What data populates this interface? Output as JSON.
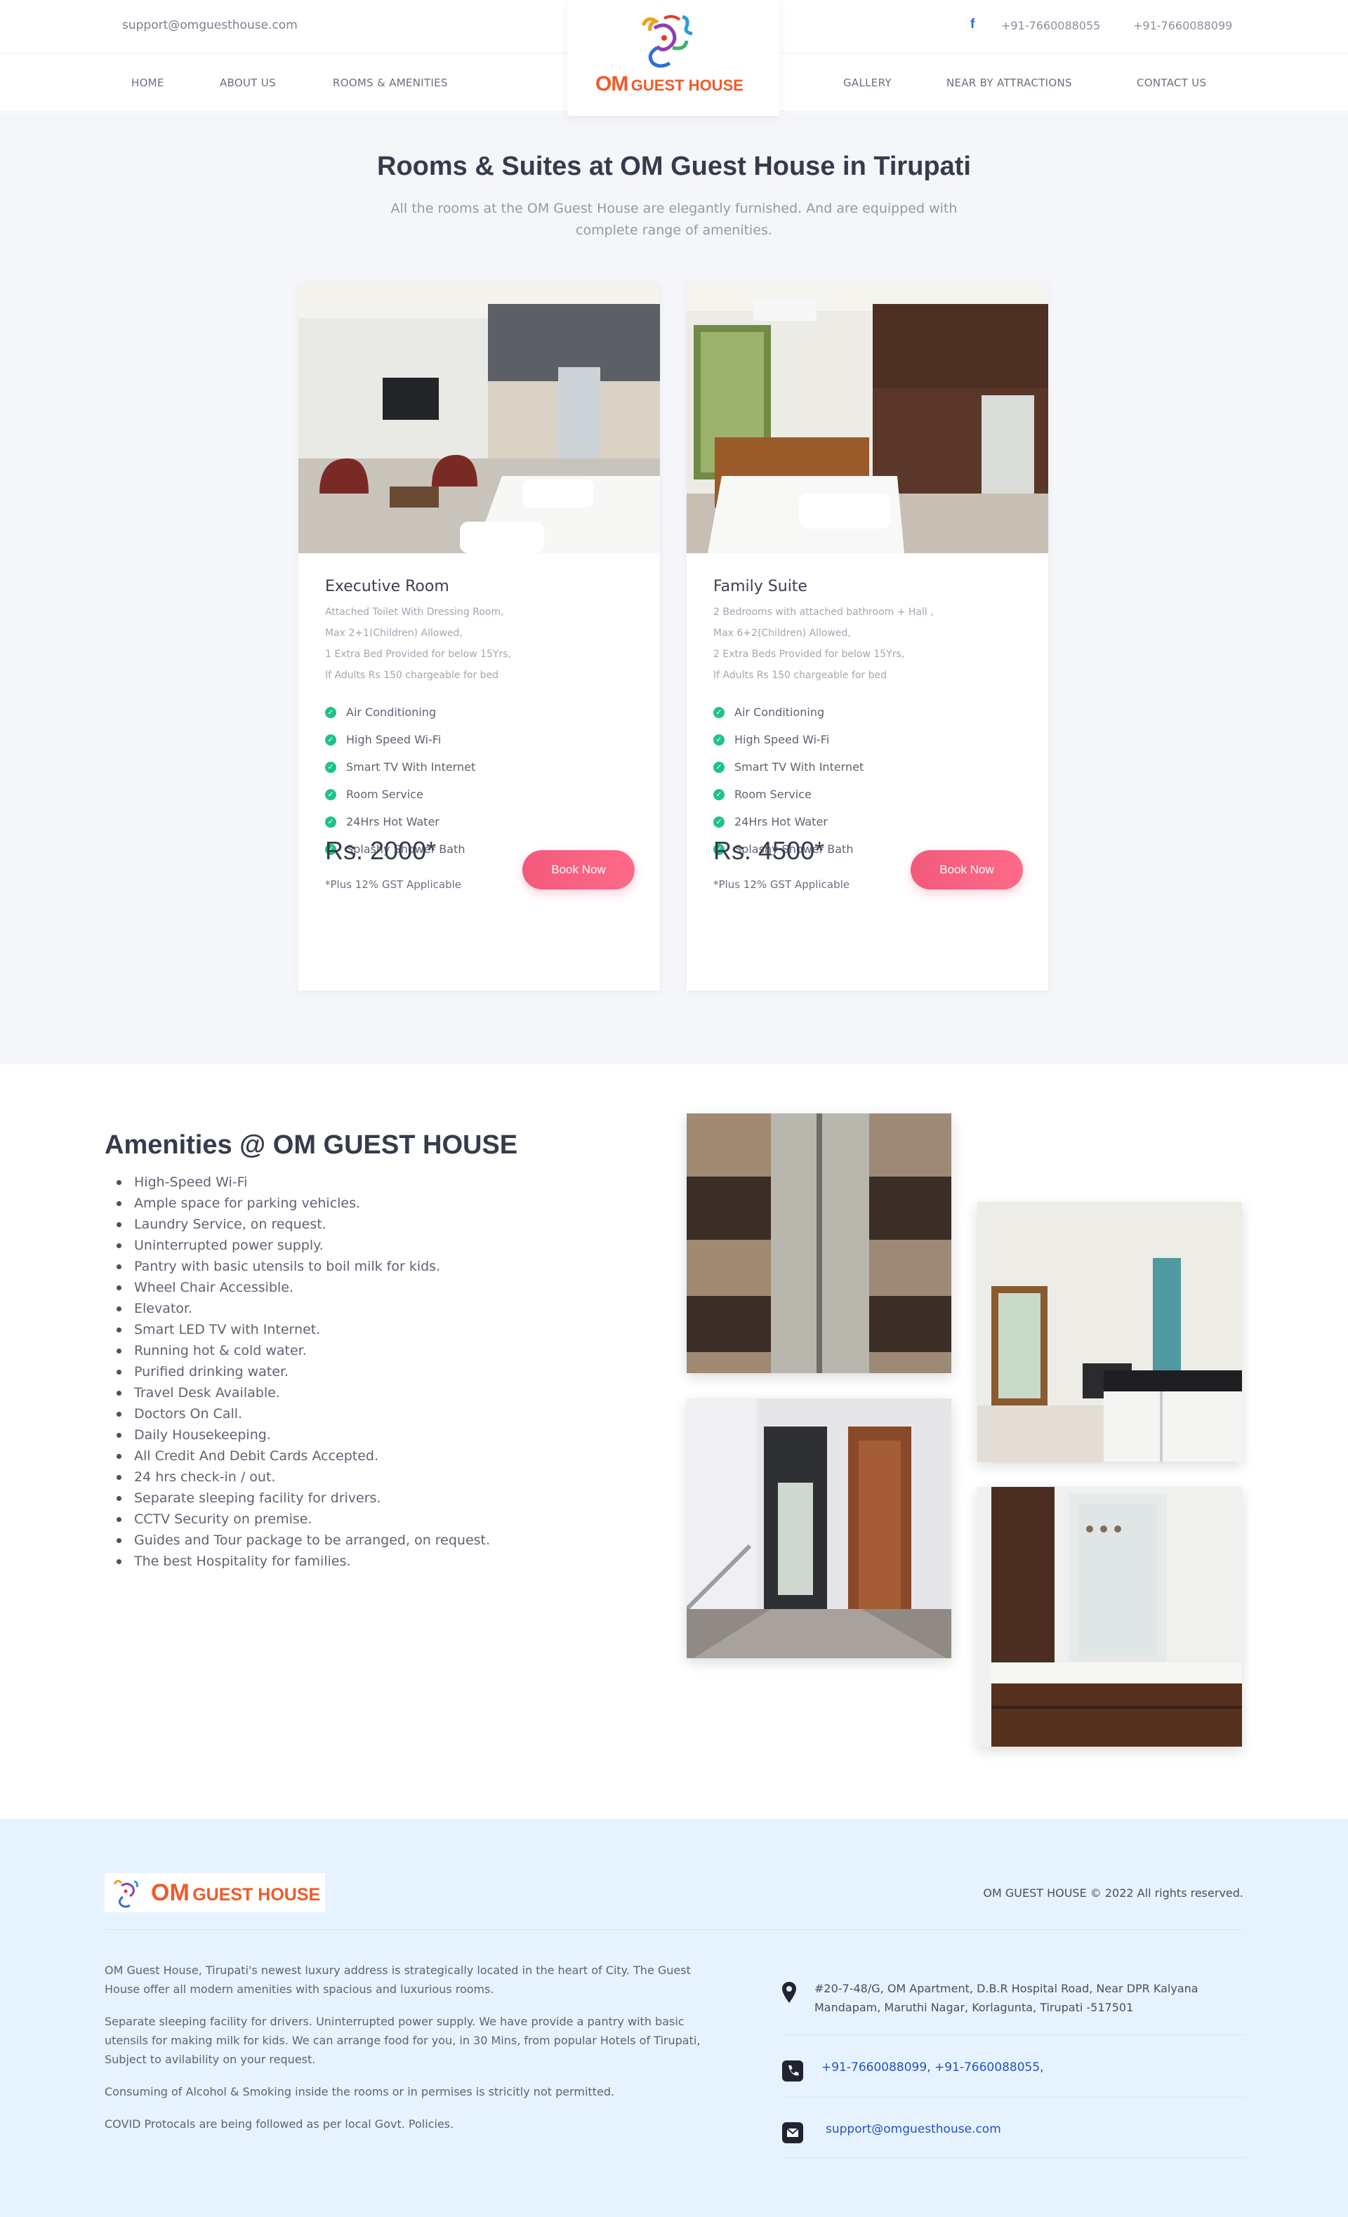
{
  "topbar": {
    "email": "support@omguesthouse.com",
    "facebook_icon": "facebook-icon",
    "phone1": "+91-7660088055",
    "phone2": "+91-7660088099"
  },
  "nav": {
    "items": [
      "HOME",
      "ABOUT US",
      "ROOMS & AMENITIES",
      "GALLERY",
      "NEAR BY ATTRACTIONS",
      "CONTACT US"
    ]
  },
  "logo": {
    "om": "OM",
    "guest_house": "GUEST HOUSE"
  },
  "rooms": {
    "title": "Rooms & Suites at OM Guest House in Tirupati",
    "subtitle": "All the rooms at the OM Guest House are elegantly furnished. And are equipped with complete range of amenities.",
    "cards": [
      {
        "name": "Executive Room",
        "desc": [
          "Attached Toilet With Dressing Room,",
          "Max 2+1(Children) Allowed,",
          "1 Extra Bed Provided for below 15Yrs,",
          "If Adults Rs 150 chargeable for bed"
        ],
        "amenities": [
          "Air Conditioning",
          "High Speed Wi-Fi",
          "Smart TV With Internet",
          "Room Service",
          "24Hrs Hot Water",
          "Splashy Shower Bath"
        ],
        "price": "Rs. 2000*",
        "gst": "*Plus 12% GST Applicable",
        "book_label": "Book Now"
      },
      {
        "name": "Family Suite",
        "desc": [
          "2 Bedrooms with attached bathroom + Hall ,",
          "Max 6+2(Children) Allowed,",
          "2 Extra Beds Provided for below 15Yrs,",
          "If Adults Rs 150 chargeable for bed"
        ],
        "amenities": [
          "Air Conditioning",
          "High Speed Wi-Fi",
          "Smart TV With Internet",
          "Room Service",
          "24Hrs Hot Water",
          "Splashy Shower Bath"
        ],
        "price": "Rs. 4500*",
        "gst": "*Plus 12% GST Applicable",
        "book_label": "Book Now"
      }
    ]
  },
  "amenities": {
    "title": "Amenities @ OM GUEST HOUSE",
    "items": [
      "High-Speed Wi-Fi",
      "Ample space for parking vehicles.",
      "Laundry Service, on request.",
      "Uninterrupted power supply.",
      "Pantry with basic utensils to boil milk for kids.",
      "Wheel Chair Accessible.",
      "Elevator.",
      "Smart LED TV with Internet.",
      "Running hot & cold water.",
      "Purified drinking water.",
      "Travel Desk Available.",
      "Doctors On Call.",
      "Daily Housekeeping.",
      "All Credit And Debit Cards Accepted.",
      "24 hrs check-in / out.",
      "Separate sleeping facility for drivers.",
      "CCTV Security on premise.",
      "Guides and Tour package to be arranged, on request.",
      "The best Hospitality for families."
    ]
  },
  "footer": {
    "logo_om": "OM",
    "logo_gh": "GUEST HOUSE",
    "copyright": "OM GUEST HOUSE © 2022 All rights reserved.",
    "about": [
      "OM Guest House, Tirupati's newest luxury address is strategically located in the heart of City. The Guest House offer all modern amenities with spacious and luxurious rooms.",
      "Separate sleeping facility for drivers. Uninterrupted power supply. We have provide a pantry with basic utensils for making milk for kids. We can arrange food for you, in 30 Mins, from popular Hotels of Tirupati, Subject to avilability on your request.",
      "Consuming of Alcohol & Smoking inside the rooms or in permises is stricitly not permitted.",
      "COVID Protocals are being followed as per local Govt. Policies."
    ],
    "address": "#20-7-48/G, OM Apartment, D.B.R Hospital Road, Near DPR Kalyana Mandapam, Maruthi Nagar, Korlagunta, Tirupati -517501",
    "phones": "+91-7660088099, +91-7660088055,",
    "email": "support@omguesthouse.com",
    "icons": {
      "address": "map-pin-icon",
      "phone": "phone-icon",
      "email": "envelope-icon"
    }
  },
  "colors": {
    "accent_pink": "#ff5a7e",
    "check_green": "#1fc28a",
    "logo_orange": "#ef5a2a",
    "link_blue": "#2252c7",
    "footer_bg": "#e6f2fd",
    "section_bg": "#f5f6fa"
  }
}
